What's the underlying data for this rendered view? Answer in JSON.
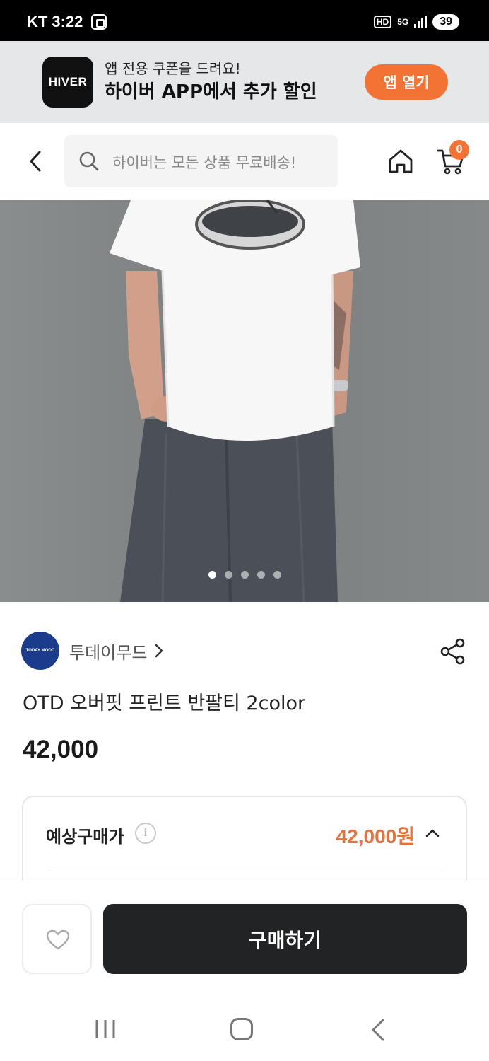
{
  "status_bar": {
    "carrier": "KT",
    "time": "3:22",
    "network_hd": "HD",
    "network_5g": "5G",
    "battery": "39"
  },
  "app_banner": {
    "logo_text": "HIVER",
    "subtitle": "앱 전용 쿠폰을 드려요!",
    "title": "하이버 APP에서 추가 할인",
    "open_button_label": "앱 열기"
  },
  "header": {
    "search_placeholder": "하이버는 모든 상품 무료배송!",
    "cart_count": "0"
  },
  "gallery": {
    "slide_count": 5,
    "active_index": 0
  },
  "product": {
    "brand_logo_text": "TODAY MOOD",
    "brand_name": "투데이무드",
    "title": "OTD 오버핏 프린트 반팔티 2color",
    "price": "42,000"
  },
  "price_summary": {
    "label": "예상구매가",
    "info_icon_text": "i",
    "value": "42,000원"
  },
  "bottom_bar": {
    "buy_label": "구매하기"
  },
  "colors": {
    "accent": "#f37335",
    "price_accent": "#e8713b",
    "buy_button": "#222325",
    "brand_avatar": "#1b3b8c"
  }
}
